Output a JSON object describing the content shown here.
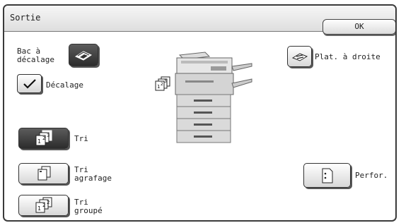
{
  "dialog": {
    "title": "Sortie",
    "ok_label": "OK"
  },
  "options": {
    "offset_tray_label": "Bac à\ndécalage",
    "offset_checkbox_label": "Décalage",
    "offset_checked": true,
    "face_up_right_label": "Plat. à droite",
    "sort_label": "Tri",
    "sort_staple_label": "Tri\nagrafage",
    "group_label": "Tri\ngroupé",
    "punch_label": "Perfor."
  },
  "icons": {
    "offset_tray": "offset-tray-icon",
    "face_up_right": "face-up-tray-icon",
    "sort": "sort-icon",
    "staple_sort": "staple-sort-icon",
    "group": "group-icon",
    "punch": "punch-icon",
    "printer": "printer-icon"
  },
  "colors": {
    "active_button": "#3a3a3a",
    "border": "#3a3a3a"
  }
}
